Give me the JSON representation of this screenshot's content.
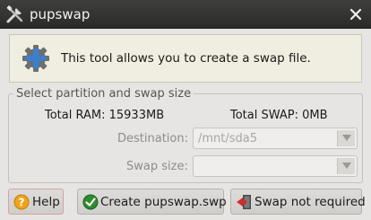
{
  "window": {
    "title": "pupswap",
    "icon": "tools-icon",
    "close_icon": "close-icon"
  },
  "info": {
    "icon": "plus-gear-icon",
    "text": "This tool allows you to create a swap file."
  },
  "partition_group": {
    "title": "Select partition and swap size",
    "total_ram": "Total RAM: 15933MB",
    "total_swap": "Total SWAP: 0MB",
    "destination_label": "Destination:",
    "destination_value": "/mnt/sda5",
    "swap_size_label": "Swap size:",
    "swap_size_value": ""
  },
  "buttons": {
    "help": {
      "label": "Help",
      "icon": "help-icon"
    },
    "create": {
      "label": "Create pupswap.swp",
      "icon": "check-icon"
    },
    "not_required": {
      "label": "Swap not required",
      "icon": "exit-icon"
    }
  },
  "colors": {
    "titlebar": "#2f2f2d",
    "info_bg": "#efeee0",
    "window_bg": "#e6e5e3"
  }
}
